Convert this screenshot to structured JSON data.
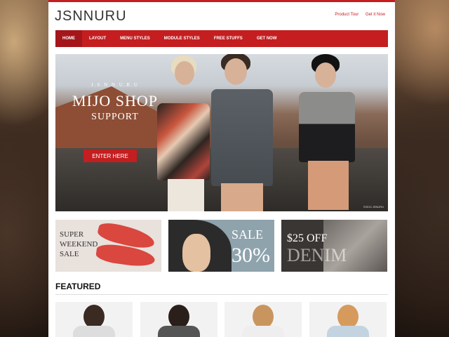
{
  "site": {
    "logo": "JSNNURU"
  },
  "top_links": [
    {
      "label": "Product Tour"
    },
    {
      "label": "Get it Now"
    }
  ],
  "nav": [
    {
      "label": "HOME",
      "active": true
    },
    {
      "label": "LAYOUT",
      "active": false
    },
    {
      "label": "MENU STYLES",
      "active": false
    },
    {
      "label": "MODULE STYLES",
      "active": false
    },
    {
      "label": "FREE STUFFS",
      "active": false
    },
    {
      "label": "GET NOW",
      "active": false
    }
  ],
  "hero": {
    "kicker": "J.S.N.N.U.R.U",
    "title": "MIJO SHOP",
    "subtitle": "SUPPORT",
    "button": "ENTER HERE",
    "credit": "©2013 JSNURU"
  },
  "promos": [
    {
      "lines": [
        "SUPER",
        "WEEKEND",
        "SALE"
      ]
    },
    {
      "line1": "SALE",
      "line2": "30%"
    },
    {
      "line1": "$25 OFF",
      "line2": "DENIM"
    }
  ],
  "featured": {
    "heading": "FEATURED"
  },
  "colors": {
    "accent": "#c41e20",
    "nav_active": "#a4161a"
  }
}
